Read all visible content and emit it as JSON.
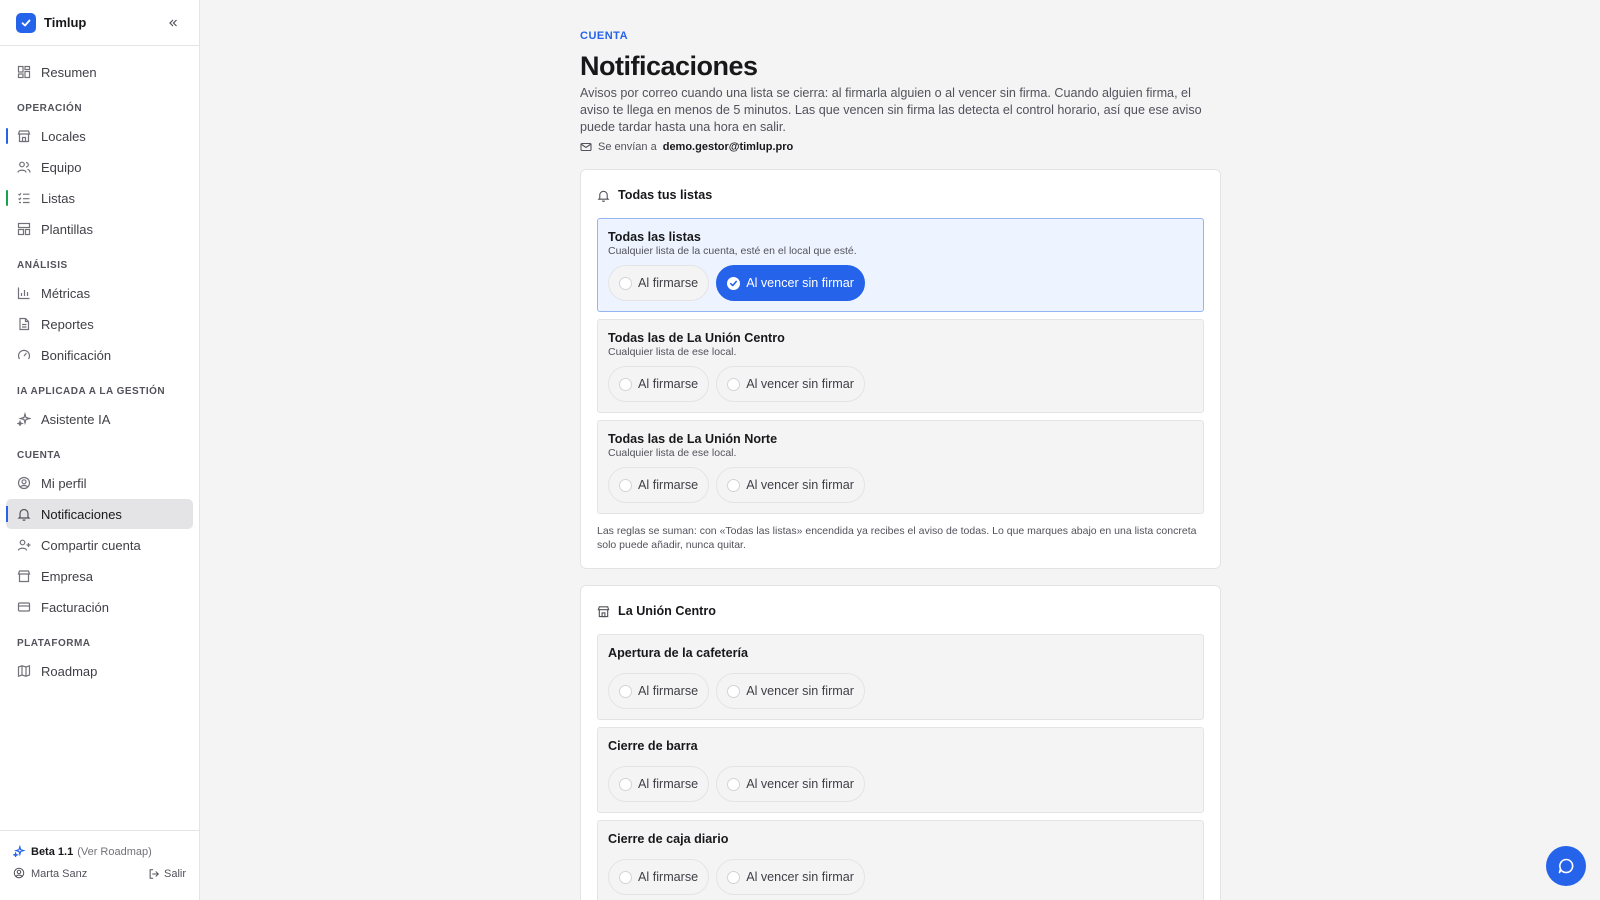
{
  "brand": {
    "name": "Timlup"
  },
  "sidebar": {
    "top": {
      "label": "Resumen",
      "icon": "dashboard-icon"
    },
    "sections": [
      {
        "label": "OPERACIÓN",
        "items": [
          {
            "label": "Locales",
            "icon": "store-icon"
          },
          {
            "label": "Equipo",
            "icon": "users-icon"
          },
          {
            "label": "Listas",
            "icon": "checklist-icon"
          },
          {
            "label": "Plantillas",
            "icon": "templates-icon"
          }
        ]
      },
      {
        "label": "ANÁLISIS",
        "items": [
          {
            "label": "Métricas",
            "icon": "bar-chart-icon"
          },
          {
            "label": "Reportes",
            "icon": "document-icon"
          },
          {
            "label": "Bonificación",
            "icon": "gauge-icon"
          }
        ]
      },
      {
        "label": "IA APLICADA A LA GESTIÓN",
        "items": [
          {
            "label": "Asistente IA",
            "icon": "sparkles-icon"
          }
        ]
      },
      {
        "label": "CUENTA",
        "items": [
          {
            "label": "Mi perfil",
            "icon": "user-circle-icon"
          },
          {
            "label": "Notificaciones",
            "icon": "bell-icon"
          },
          {
            "label": "Compartir cuenta",
            "icon": "user-plus-icon"
          },
          {
            "label": "Empresa",
            "icon": "building-icon"
          },
          {
            "label": "Facturación",
            "icon": "credit-card-icon"
          }
        ]
      },
      {
        "label": "PLATAFORMA",
        "items": [
          {
            "label": "Roadmap",
            "icon": "map-icon"
          }
        ]
      }
    ],
    "footer": {
      "version": "Beta 1.1",
      "roadmap_link": "(Ver Roadmap)",
      "user": "Marta Sanz",
      "logout": "Salir"
    }
  },
  "page": {
    "eyebrow": "CUENTA",
    "title": "Notificaciones",
    "description": "Avisos por correo cuando una lista se cierra: al firmarla alguien o al vencer sin firma. Cuando alguien firma, el aviso te llega en menos de 5 minutos. Las que vencen sin firma las detecta el control horario, así que ese aviso puede tardar hasta una hora en salir.",
    "sent_to_label": "Se envían a",
    "sent_to_email": "demo.gestor@timlup.pro"
  },
  "options": {
    "on_sign": "Al firmarse",
    "on_expire": "Al vencer sin firmar"
  },
  "all_lists_card": {
    "title": "Todas tus listas",
    "rules": [
      {
        "title": "Todas las listas",
        "subtitle": "Cualquier lista de la cuenta, esté en el local que esté.",
        "on_sign": false,
        "on_expire": true
      },
      {
        "title": "Todas las de La Unión Centro",
        "subtitle": "Cualquier lista de ese local.",
        "on_sign": false,
        "on_expire": false
      },
      {
        "title": "Todas las de La Unión Norte",
        "subtitle": "Cualquier lista de ese local.",
        "on_sign": false,
        "on_expire": false
      }
    ],
    "note": "Las reglas se suman: con «Todas las listas» encendida ya recibes el aviso de todas. Lo que marques abajo en una lista concreta solo puede añadir, nunca quitar."
  },
  "location_card": {
    "title": "La Unión Centro",
    "lists": [
      {
        "title": "Apertura de la cafetería",
        "on_sign": false,
        "on_expire": false
      },
      {
        "title": "Cierre de barra",
        "on_sign": false,
        "on_expire": false
      },
      {
        "title": "Cierre de caja diario",
        "on_sign": false,
        "on_expire": false
      }
    ]
  },
  "colors": {
    "accent": "#2563eb",
    "selected_bg": "#eef4ff",
    "green_marker": "#16a34a"
  }
}
